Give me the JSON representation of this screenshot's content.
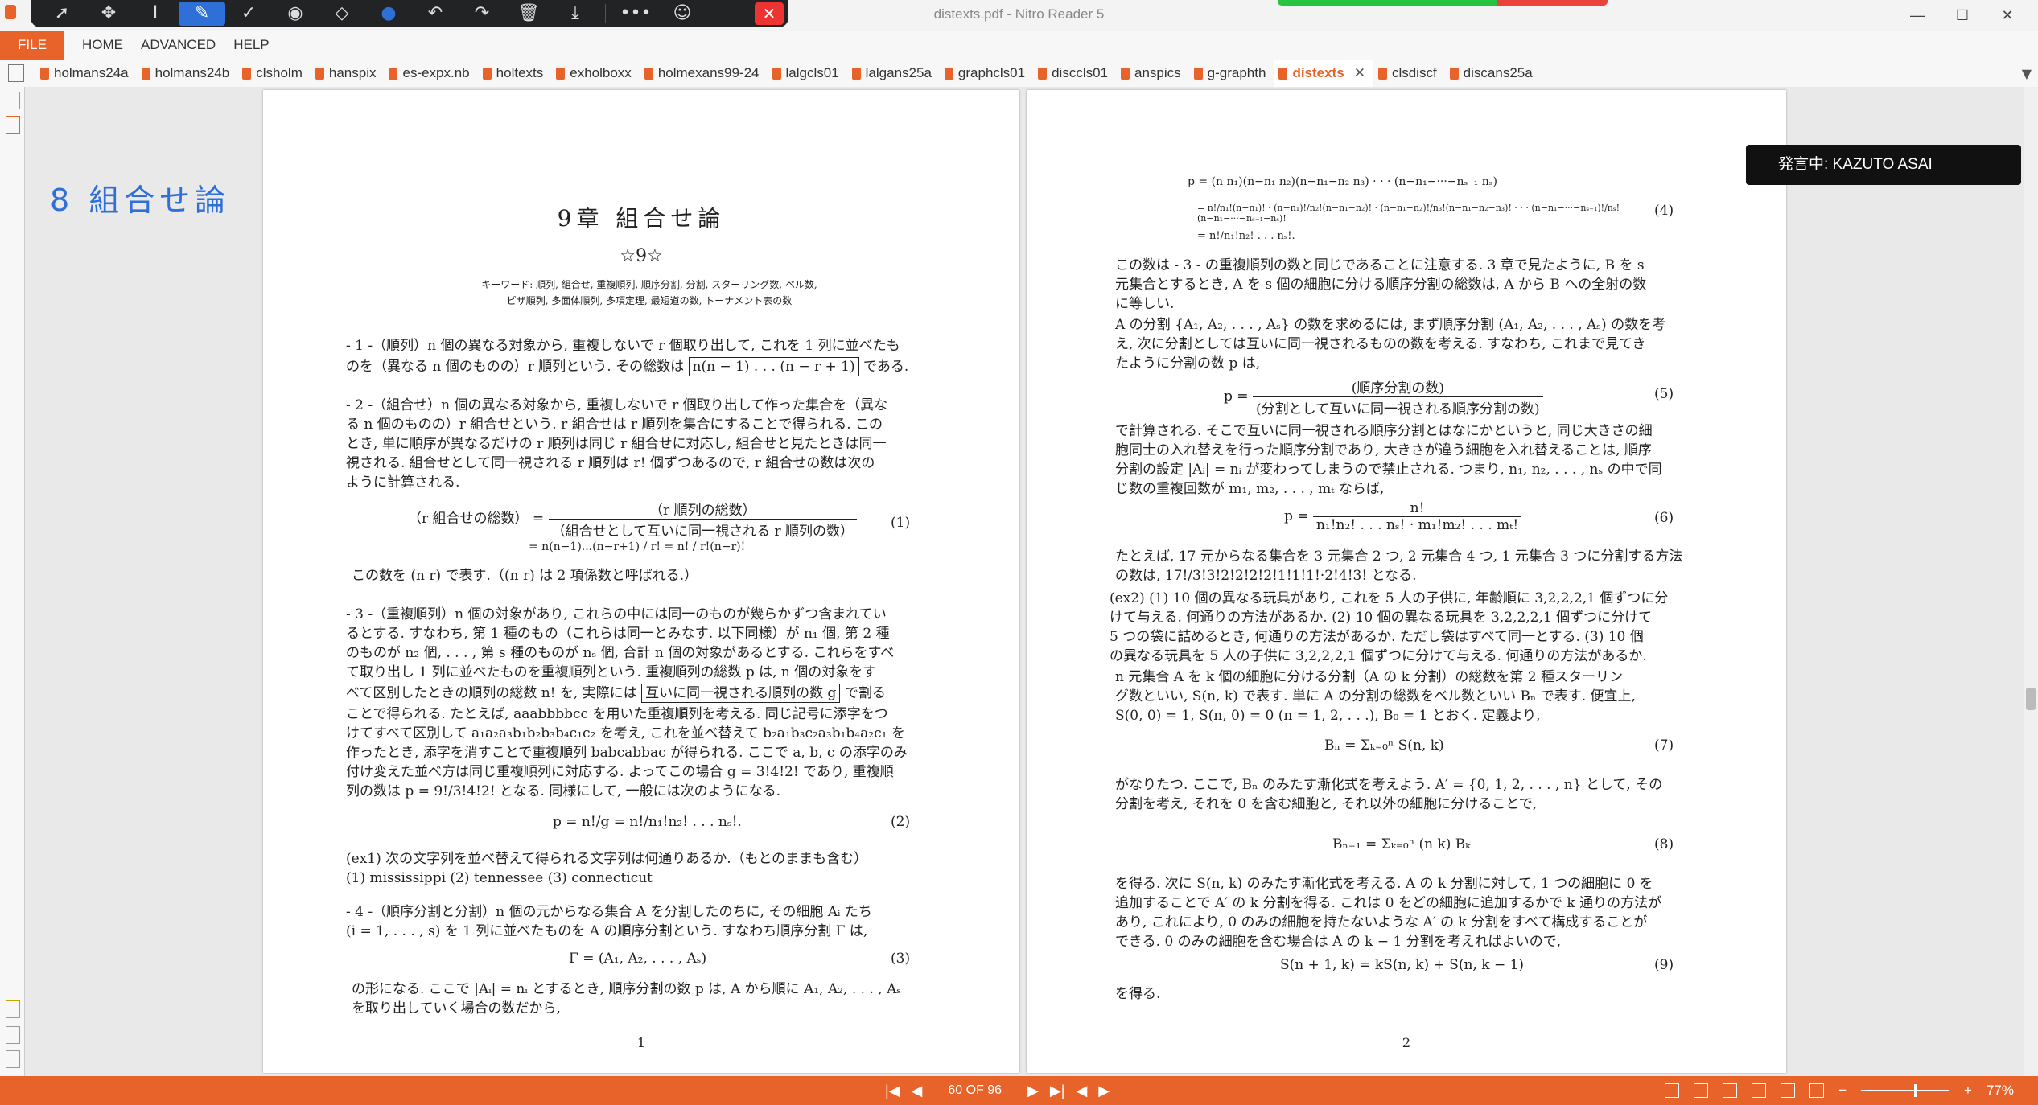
{
  "window": {
    "title": "distexts.pdf - Nitro Reader 5",
    "minimize": "—",
    "maximize": "☐",
    "close": "✕"
  },
  "draw_toolbar": {
    "tools": [
      {
        "name": "select-arrow-icon",
        "glyph": "➚"
      },
      {
        "name": "pan-icon",
        "glyph": "✥"
      },
      {
        "name": "text-cursor-icon",
        "glyph": "I"
      },
      {
        "name": "pen-icon",
        "glyph": "✎"
      },
      {
        "name": "check-icon",
        "glyph": "✓"
      },
      {
        "name": "stamp-icon",
        "glyph": "◉"
      },
      {
        "name": "eraser-icon",
        "glyph": "◇"
      },
      {
        "name": "color-dot-icon",
        "glyph": "●"
      },
      {
        "name": "undo-icon",
        "glyph": "↶"
      },
      {
        "name": "redo-icon",
        "glyph": "↷"
      },
      {
        "name": "trash-icon",
        "glyph": "🗑"
      },
      {
        "name": "download-icon",
        "glyph": "⤓"
      },
      {
        "name": "more-icon",
        "glyph": "•••"
      },
      {
        "name": "user-settings-icon",
        "glyph": "☺"
      }
    ],
    "close_glyph": "✕",
    "accent": "#2f6fd8"
  },
  "menu": {
    "file": "FILE",
    "items": [
      "HOME",
      "ADVANCED",
      "HELP"
    ]
  },
  "tabs": [
    {
      "label": "holmans24a"
    },
    {
      "label": "holmans24b"
    },
    {
      "label": "clsholm"
    },
    {
      "label": "hanspix"
    },
    {
      "label": "es-expx.nb"
    },
    {
      "label": "holtexts"
    },
    {
      "label": "exholboxx"
    },
    {
      "label": "holmexans99-24"
    },
    {
      "label": "lalgcls01"
    },
    {
      "label": "lalgans25a"
    },
    {
      "label": "graphcls01"
    },
    {
      "label": "disccls01"
    },
    {
      "label": "anspics"
    },
    {
      "label": "g-graphth"
    },
    {
      "label": "distexts",
      "active": true,
      "close": "✕"
    },
    {
      "label": "clsdiscf"
    },
    {
      "label": "discans25a"
    }
  ],
  "annotation": {
    "handwriting": "8 組合せ論"
  },
  "speaker_badge": "発言中: KAZUTO ASAI",
  "page1": {
    "chapter": "9章 組合せ論",
    "star": "☆9☆",
    "keywords_1": "キーワード: 順列, 組合せ, 重複順列, 順序分割, 分割, スターリング数, ベル数,",
    "keywords_2": "ピザ順列, 多面体順列, 多項定理, 最短道の数, トーナメント表の数",
    "s1_a": "- 1 -（順列）n 個の異なる対象から, 重複しないで r 個取り出して, これを 1 列に並べたも",
    "s1_b": "のを（異なる n 個のものの）r 順列という. その総数は",
    "s1_box": "n(n − 1) . . . (n − r + 1)",
    "s1_c": "である.",
    "s2_lines": [
      "- 2 -（組合せ）n 個の異なる対象から, 重複しないで r 個取り出して作った集合を（異な",
      "る n 個のものの）r 組合せという. r 組合せは r 順列を集合にすることで得られる. この",
      "とき, 単に順序が異なるだけの r 順列は同じ r 組合せに対応し, 組合せと見たときは同一",
      "視される. 組合せとして同一視される r 順列は r! 個ずつあるので, r 組合せの数は次の",
      "ように計算される."
    ],
    "eq1_lhs": "（r 組合せの総数）",
    "eq1_num": "（r 順列の総数）",
    "eq1_den": "（組合せとして互いに同一視される r 順列の数）",
    "eq1_line2": "= n(n−1)...(n−r+1) / r! = n! / r!(n−r)!",
    "eq1_no": "(1)",
    "binom_note": "この数を (n r) で表す.（(n r) は 2 項係数と呼ばれる.）",
    "s3_lines": [
      "- 3 -（重複順列）n 個の対象があり, これらの中には同一のものが幾らかずつ含まれてい",
      "るとする. すなわち, 第 1 種のもの（これらは同一とみなす. 以下同様）が n₁ 個, 第 2 種",
      "のものが n₂ 個, . . . , 第 s 種のものが nₛ 個, 合計 n 個の対象があるとする. これらをすべ",
      "て取り出し 1 列に並べたものを重複順列という. 重複順列の総数 p は, n 個の対象をす"
    ],
    "s3_box_pre": "べて区別したときの順列の総数 n! を, 実際には",
    "s3_box": "互いに同一視される順列の数 g",
    "s3_box_post": "で割る",
    "s3_lines2": [
      "ことで得られる. たとえば, aaabbbbcc を用いた重複順列を考える. 同じ記号に添字をつ",
      "けてすべて区別して a₁a₂a₃b₁b₂b₃b₄c₁c₂ を考え, これを並べ替えて b₂a₁b₃c₂a₃b₁b₄a₂c₁ を",
      "作ったとき, 添字を消すことで重複順列 babcabbac が得られる. ここで a, b, c の添字のみ",
      "付け変えた並べ方は同じ重複順列に対応する. よってこの場合 g = 3!4!2! であり, 重複順",
      "列の数は p = 9!/3!4!2! となる. 同様にして, 一般には次のようになる."
    ],
    "eq2": "p = n!/g = n!/n₁!n₂! . . . nₛ!.",
    "eq2_no": "(2)",
    "ex1_a": "(ex1) 次の文字列を並べ替えて得られる文字列は何通りあるか.（もとのままも含む）",
    "ex1_b": "(1) mississippi   (2) tennessee   (3) connecticut",
    "s4_a": "- 4 -（順序分割と分割）n 個の元からなる集合 A を分割したのちに, その細胞 Aᵢ たち",
    "s4_b": "(i = 1, . . . , s) を 1 列に並べたものを A の順序分割という. すなわち順序分割 Γ は,",
    "eq3": "Γ = (A₁, A₂, . . . , Aₛ)",
    "eq3_no": "(3)",
    "s4_c": "の形になる. ここで |Aᵢ| = nᵢ とするとき, 順序分割の数 p は, A から順に A₁, A₂, . . . , Aₛ",
    "s4_d": "を取り出していく場合の数だから,",
    "page_no": "1"
  },
  "page2": {
    "eq4_a": "p = (n n₁)(n−n₁ n₂)(n−n₁−n₂ n₃) · · · (n−n₁−···−nₛ₋₁ nₛ)",
    "eq4_b": "= n!/n₁!(n−n₁)! · (n−n₁)!/n₂!(n−n₁−n₂)! · (n−n₁−n₂)!/n₃!(n−n₁−n₂−n₃)! · · · (n−n₁−···−nₛ₋₁)!/nₛ!(n−n₁−···−nₛ₋₁−nₛ)!",
    "eq4_c": "= n!/n₁!n₂! . . . nₛ!.",
    "eq4_no": "(4)",
    "p_lines": [
      "この数は - 3 - の重複順列の数と同じであることに注意する. 3 章で見たように, B を s",
      "元集合とするとき, A を s 個の細胞に分ける順序分割の総数は, A から B への全射の数",
      "に等しい."
    ],
    "p2_lines": [
      "  A の分割 {A₁, A₂, . . . , Aₛ} の数を求めるには, まず順序分割 (A₁, A₂, . . . , Aₛ) の数を考",
      "え, 次に分割としては互いに同一視されるものの数を考える. すなわち, これまで見てき",
      "たように分割の数 p は,"
    ],
    "eq5_num": "(順序分割の数)",
    "eq5_den": "(分割として互いに同一視される順序分割の数)",
    "eq5_no": "(5)",
    "p3_lines": [
      "で計算される. そこで互いに同一視される順序分割とはなにかというと, 同じ大きさの細",
      "胞同士の入れ替えを行った順序分割であり, 大きさが違う細胞を入れ替えることは, 順序",
      "分割の設定 |Aᵢ| = nᵢ が変わってしまうので禁止される. つまり, n₁, n₂, . . . , nₛ の中で同",
      "じ数の重複回数が m₁, m₂, . . . , mₜ ならば,"
    ],
    "eq6_num": "n!",
    "eq6_den": "n₁!n₂! . . . nₛ! · m₁!m₂! . . . mₜ!",
    "eq6_no": "(6)",
    "p4_lines": [
      "たとえば, 17 元からなる集合を 3 元集合 2 つ, 2 元集合 4 つ, 1 元集合 3 つに分割する方法",
      "の数は, 17!/3!3!2!2!2!2!1!1!1!·2!4!3! となる."
    ],
    "ex2_lines": [
      "(ex2) (1) 10 個の異なる玩具があり, これを 5 人の子供に, 年齢順に 3,2,2,2,1 個ずつに分",
      "けて与える. 何通りの方法があるか. (2) 10 個の異なる玩具を 3,2,2,2,1 個ずつに分けて",
      "5 つの袋に詰めるとき, 何通りの方法があるか. ただし袋はすべて同一とする. (3) 10 個",
      "の異なる玩具を 5 人の子供に 3,2,2,2,1 個ずつに分けて与える. 何通りの方法があるか."
    ],
    "p5_lines": [
      "  n 元集合 A を k 個の細胞に分ける分割（A の k 分割）の総数を第 2 種スターリン",
      "グ数といい, S(n, k) で表す. 単に A の分割の総数をベル数といい Bₙ で表す. 便宜上,",
      "S(0, 0) = 1, S(n, 0) = 0 (n = 1, 2, . . .), B₀ = 1 とおく. 定義より,"
    ],
    "eq7": "Bₙ = Σₖ₌₀ⁿ S(n, k)",
    "eq7_no": "(7)",
    "p6_lines": [
      "がなりたつ. ここで, Bₙ のみたす漸化式を考えよう. A′ = {0, 1, 2, . . . , n} として, その",
      "分割を考え, それを 0 を含む細胞と, それ以外の細胞に分けることで,"
    ],
    "eq8": "Bₙ₊₁ = Σₖ₌₀ⁿ (n k) Bₖ",
    "eq8_no": "(8)",
    "p7_lines": [
      "を得る. 次に S(n, k) のみたす漸化式を考える. A の k 分割に対して, 1 つの細胞に 0 を",
      "追加することで A′ の k 分割を得る. これは 0 をどの細胞に追加するかで k 通りの方法が",
      "あり, これにより, 0 のみの細胞を持たないような A′ の k 分割をすべて構成することが",
      "できる. 0 のみの細胞を含む場合は A の k − 1 分割を考えればよいので,"
    ],
    "eq9": "S(n + 1, k) = kS(n, k) + S(n, k − 1)",
    "eq9_no": "(9)",
    "p8": "を得る.",
    "page_no": "2"
  },
  "statusbar": {
    "first": "|◀",
    "prev": "◀",
    "page_info": "60 OF 96",
    "next": "▶",
    "last": "▶|",
    "back": "◀",
    "forward": "▶",
    "zoom_minus": "−",
    "zoom_plus": "+",
    "zoom": "77%",
    "accent": "#e8632a"
  }
}
